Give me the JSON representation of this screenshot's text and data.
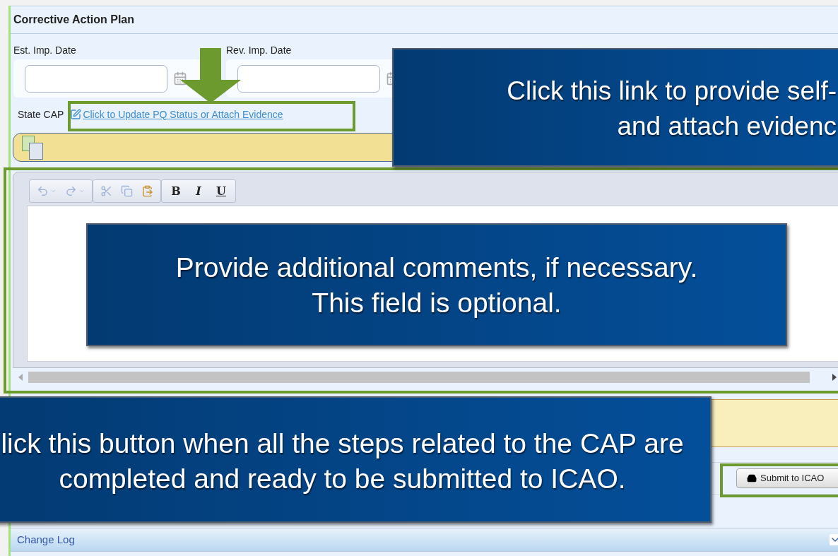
{
  "panel": {
    "title": "Corrective Action Plan",
    "date_fields": [
      {
        "label": "Est. Imp. Date"
      },
      {
        "label": "Rev. Imp. Date"
      }
    ],
    "state_cap": {
      "label": "State CAP",
      "link": "Click to Update PQ Status or Attach Evidence"
    },
    "editor": {
      "toolbar": [
        [
          {
            "kind": "undo",
            "disabled": true
          },
          {
            "kind": "redo",
            "disabled": true
          }
        ],
        [
          {
            "kind": "cut",
            "disabled": true
          },
          {
            "kind": "copy",
            "disabled": true
          },
          {
            "kind": "paste",
            "disabled": false
          }
        ],
        [
          {
            "kind": "bold",
            "label": "B",
            "disabled": false
          },
          {
            "kind": "italic",
            "label": "I",
            "disabled": false
          },
          {
            "kind": "underline",
            "label": "U",
            "disabled": false
          }
        ]
      ]
    },
    "submit_button": "Submit to ICAO",
    "change_log": "Change Log"
  },
  "callouts": [
    {
      "kind": "link",
      "lines": [
        "Click this link to provide self-",
        "and attach evidenc"
      ]
    },
    {
      "kind": "editor",
      "lines": [
        "Provide additional comments, if necessary.",
        "This field is optional."
      ]
    },
    {
      "kind": "button",
      "lines": [
        "lick this button when all the steps related to the CAP are",
        "completed and ready to be submitted to ICAO."
      ]
    }
  ]
}
